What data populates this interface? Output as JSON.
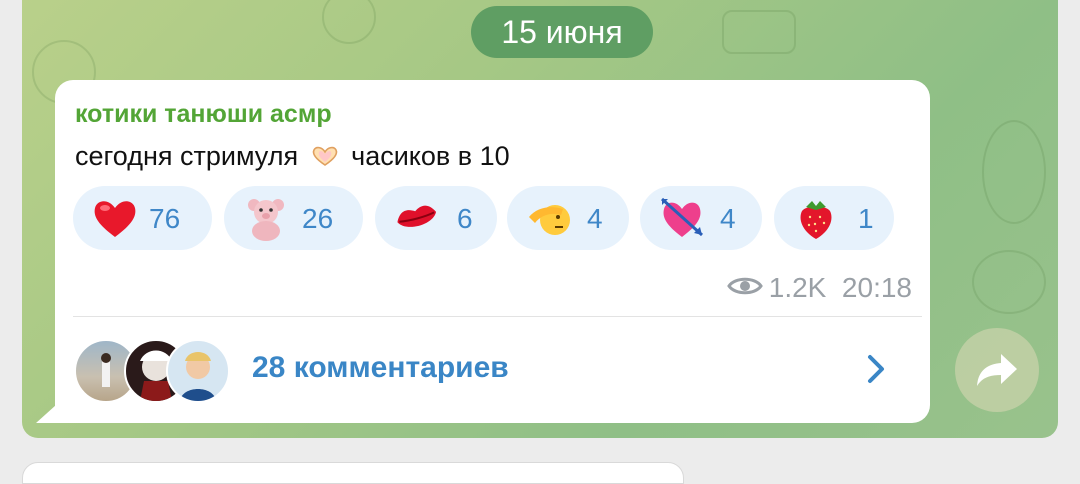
{
  "date": "15 июня",
  "post": {
    "sender": "котики танюши асмр",
    "text_before": "сегодня стримуля",
    "text_after": "часиков в 10",
    "reactions": [
      {
        "icon": "heart-emoji",
        "count": "76"
      },
      {
        "icon": "teddy-bear-emoji",
        "count": "26"
      },
      {
        "icon": "kiss-lips-emoji",
        "count": "6"
      },
      {
        "icon": "saluting-face-emoji",
        "count": "4"
      },
      {
        "icon": "heart-with-arrow-emoji",
        "count": "4"
      },
      {
        "icon": "strawberry-emoji",
        "count": "1"
      }
    ],
    "views": "1.2K",
    "time": "20:18",
    "comments_label": "28 комментариев"
  },
  "colors": {
    "sender": "#53a536",
    "accent": "#3a86c6",
    "reaction_bg": "#e7f2fc",
    "date_pill": "#5f9e63"
  }
}
